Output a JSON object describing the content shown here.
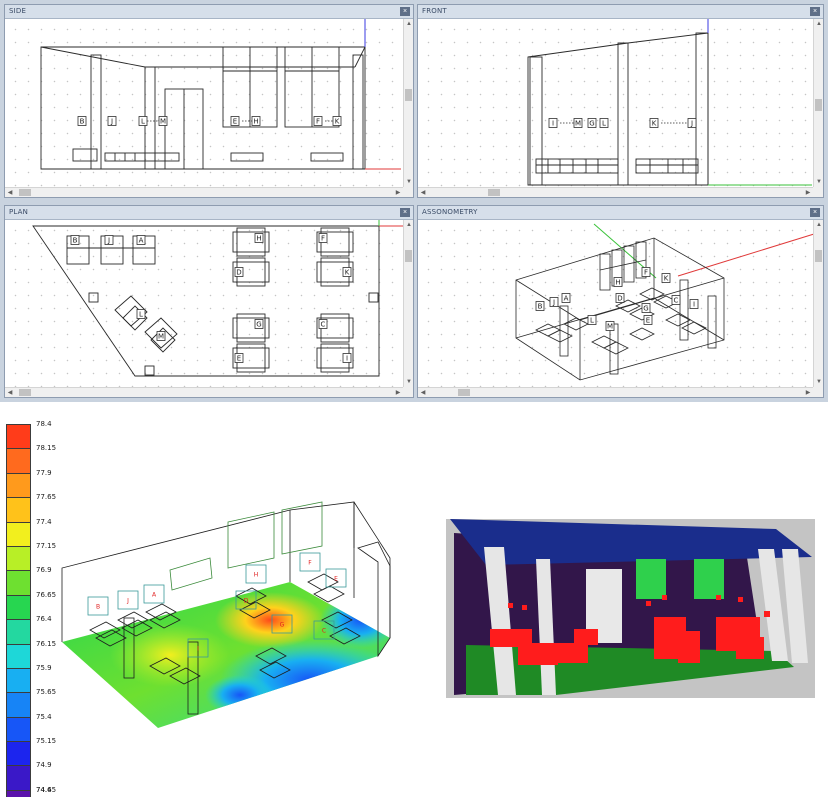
{
  "panes": {
    "side": {
      "title": "SIDE",
      "close_icon": "close-icon"
    },
    "front": {
      "title": "FRONT",
      "close_icon": "close-icon"
    },
    "plan": {
      "title": "PLAN",
      "close_icon": "close-icon"
    },
    "axonometry": {
      "title": "ASSONOMETRY",
      "close_icon": "close-icon"
    }
  },
  "labels": {
    "side": [
      "B",
      "J",
      "L",
      "M",
      "E",
      "H",
      "F",
      "K"
    ],
    "front": [
      "I",
      "M",
      "G",
      "L",
      "K",
      "J"
    ],
    "plan": [
      "B",
      "J",
      "A",
      "H",
      "F",
      "D",
      "K",
      "L",
      "M",
      "G",
      "C",
      "E",
      "I"
    ],
    "axonometry": [
      "H",
      "F",
      "K",
      "B",
      "J",
      "A",
      "D",
      "C",
      "G",
      "I",
      "E",
      "L",
      "M"
    ],
    "heatmap": [
      "B",
      "J",
      "A",
      "H",
      "F",
      "E",
      "D",
      "C",
      "G",
      "I"
    ]
  },
  "legend": {
    "values": [
      "78.4",
      "78.15",
      "77.9",
      "77.65",
      "77.4",
      "77.15",
      "76.9",
      "76.65",
      "76.4",
      "76.15",
      "75.9",
      "75.65",
      "75.4",
      "75.15",
      "74.9",
      "74.65",
      "74.4"
    ],
    "colors": [
      "#ff3c1a",
      "#ff6a1e",
      "#ff9a1c",
      "#ffc21a",
      "#f2ef1e",
      "#b8ef26",
      "#6ee030",
      "#27d650",
      "#23d8a0",
      "#1ed7d8",
      "#18aff2",
      "#1784f6",
      "#1756f7",
      "#1c25ee",
      "#3a18c8",
      "#5a12ab",
      "#6e0a92"
    ]
  },
  "render_colors": {
    "wall": "#32164a",
    "ceiling": "#1a2d8c",
    "floor": "#1f8a25",
    "furniture": "#ff1c1c",
    "window": "#2fd04c",
    "column": "#e6e6e6"
  }
}
